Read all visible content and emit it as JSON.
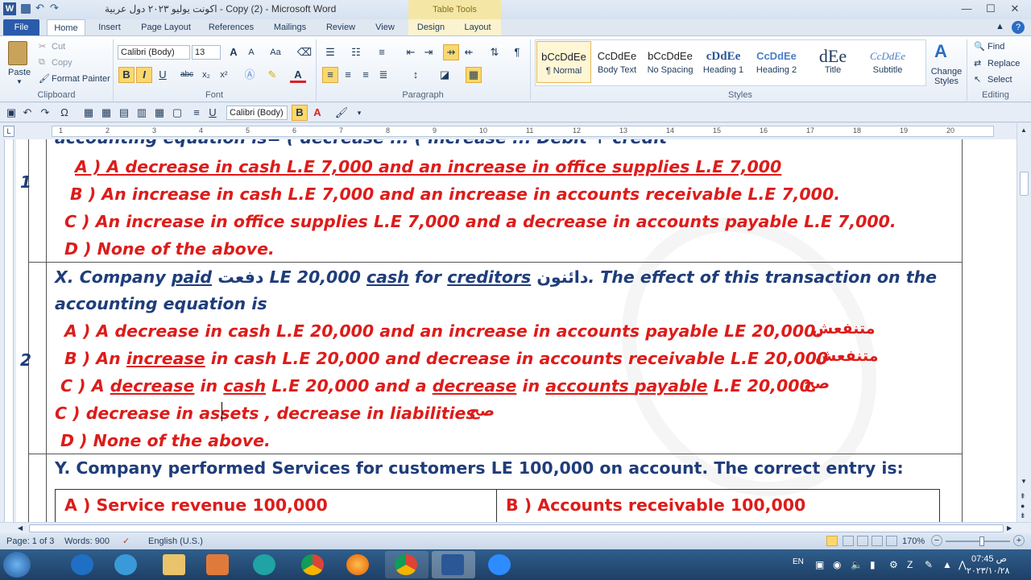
{
  "window": {
    "title": "اكونت يوليو ٢٠٢٣ دول عربية - Copy (2)  -  Microsoft Word",
    "context_tab_group": "Table Tools",
    "controls": {
      "minimize": "—",
      "maximize": "☐",
      "close": "✕"
    }
  },
  "ribbon_tabs": [
    "File",
    "Home",
    "Insert",
    "Page Layout",
    "References",
    "Mailings",
    "Review",
    "View",
    "Design",
    "Layout"
  ],
  "clipboard": {
    "paste": "Paste",
    "cut": "Cut",
    "copy": "Copy",
    "format_painter": "Format Painter",
    "group": "Clipboard"
  },
  "font": {
    "name": "Calibri (Body)",
    "size": "13",
    "group": "Font",
    "bold": "B",
    "italic": "I",
    "underline": "U",
    "strike": "abc",
    "sub": "x₂",
    "sup": "x²",
    "grow": "A",
    "shrink": "A",
    "case": "Aa",
    "color_letter": "A"
  },
  "paragraph": {
    "group": "Paragraph",
    "pilcrow": "¶"
  },
  "styles": {
    "group": "Styles",
    "items": [
      {
        "preview": "bCcDdEe",
        "name": "¶ Normal"
      },
      {
        "preview": "CcDdEe",
        "name": "Body Text"
      },
      {
        "preview": "bCcDdEe",
        "name": "No Spacing"
      },
      {
        "preview": "cDdEe",
        "name": "Heading 1"
      },
      {
        "preview": "CcDdEe",
        "name": "Heading 2"
      },
      {
        "preview": "dEe",
        "name": "Title"
      },
      {
        "preview": "CcDdEe",
        "name": "Subtitle"
      }
    ],
    "change_styles": "Change Styles"
  },
  "editing": {
    "group": "Editing",
    "find": "Find",
    "replace": "Replace",
    "select": "Select"
  },
  "qat": {
    "font": "Calibri (Body)"
  },
  "ruler_numbers": [
    "1",
    "2",
    "3",
    "4",
    "5",
    "6",
    "7",
    "8",
    "9",
    "10",
    "11",
    "12",
    "13",
    "14",
    "15",
    "16",
    "17",
    "18",
    "19",
    "20"
  ],
  "document": {
    "row1": {
      "number": "1",
      "cut_top": "accounting equation is= ( decrease  ...  ( increase  ...   Debit + credit",
      "a": "A ) A decrease  in cash L.E 7,000 and an increase  in office supplies  L.E 7,000",
      "b": "B ) An increase  in cash L.E 7,000 and an increase  in accounts  receivable  L.E 7,000.",
      "c": "C ) An increase  in office supplies  L.E 7,000 and a decrease  in accounts  payable  L.E 7,000.",
      "d": "D ) None of the above."
    },
    "row2": {
      "number": "2",
      "q_prefix": "X. Company ",
      "q_paid": "paid",
      "q_ar1": "دفعت",
      "q_mid": " LE 20,000 ",
      "q_cash": "cash",
      "q_for": " for ",
      "q_creditors": "creditors",
      "q_ar2": "دائنون",
      "q_rest": ". The effect of this transaction  on the",
      "q_line2": "accounting  equation  is",
      "a": "A ) A decrease  in cash L.E 20,000 and an increase  in accounts  payable  LE 20,000.",
      "a_ar": "متنفعش",
      "b_pre": "B ) An ",
      "b_increase": "increase",
      "b_rest": "  in cash L.E 20,000 and decrease  in accounts  receivable  L.E 20,000",
      "b_ar": "متنفعش",
      "c_pre": "C ) A ",
      "c_decrease1": "decrease",
      "c_in": "  in ",
      "c_cash": "cash",
      "c_mid": "  L.E 20,000 and a ",
      "c_decrease2": "decrease",
      "c_in2": "  in ",
      "c_accounts": "accounts",
      "c_sp": " ",
      "c_payable": "payable",
      "c_end": "  L.E 20,000.",
      "c_ar": "صح",
      "c2": "C ) decrease  in assets , decrease  in liabilities",
      "c2_ar": "صح",
      "d": "D ) None of the above."
    },
    "row3": {
      "question": "Y. Company performed Services for customers LE 100,000 on account. The correct entry is:",
      "cell_a": "A )  Service revenue 100,000",
      "cell_b": "B ) Accounts receivable 100,000"
    }
  },
  "statusbar": {
    "page": "Page: 1 of 3",
    "words": "Words: 900",
    "language": "English (U.S.)",
    "zoom": "170%"
  },
  "taskbar": {
    "lang": "EN",
    "time": "07:45 ص",
    "date": "۲۰۲۳/۱۰/۲۸"
  },
  "colors": {
    "answer_red": "#dd1c1a",
    "question_blue": "#1f3d7a",
    "ribbon_bg": "#e7eef7",
    "file_tab": "#2a5bab"
  }
}
